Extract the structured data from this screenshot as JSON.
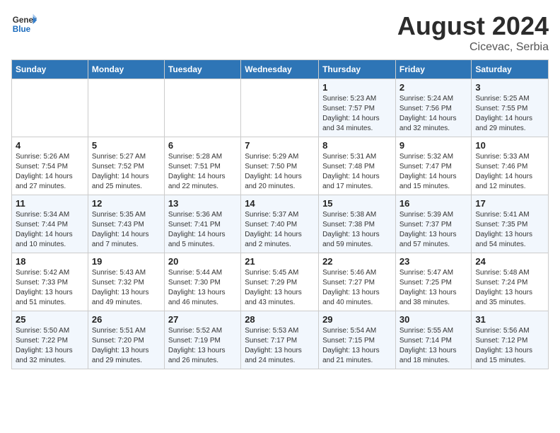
{
  "header": {
    "logo_text_general": "General",
    "logo_text_blue": "Blue",
    "main_title": "August 2024",
    "subtitle": "Cicevac, Serbia"
  },
  "days_of_week": [
    "Sunday",
    "Monday",
    "Tuesday",
    "Wednesday",
    "Thursday",
    "Friday",
    "Saturday"
  ],
  "weeks": [
    [
      {
        "day": "",
        "info": ""
      },
      {
        "day": "",
        "info": ""
      },
      {
        "day": "",
        "info": ""
      },
      {
        "day": "",
        "info": ""
      },
      {
        "day": "1",
        "info": "Sunrise: 5:23 AM\nSunset: 7:57 PM\nDaylight: 14 hours\nand 34 minutes."
      },
      {
        "day": "2",
        "info": "Sunrise: 5:24 AM\nSunset: 7:56 PM\nDaylight: 14 hours\nand 32 minutes."
      },
      {
        "day": "3",
        "info": "Sunrise: 5:25 AM\nSunset: 7:55 PM\nDaylight: 14 hours\nand 29 minutes."
      }
    ],
    [
      {
        "day": "4",
        "info": "Sunrise: 5:26 AM\nSunset: 7:54 PM\nDaylight: 14 hours\nand 27 minutes."
      },
      {
        "day": "5",
        "info": "Sunrise: 5:27 AM\nSunset: 7:52 PM\nDaylight: 14 hours\nand 25 minutes."
      },
      {
        "day": "6",
        "info": "Sunrise: 5:28 AM\nSunset: 7:51 PM\nDaylight: 14 hours\nand 22 minutes."
      },
      {
        "day": "7",
        "info": "Sunrise: 5:29 AM\nSunset: 7:50 PM\nDaylight: 14 hours\nand 20 minutes."
      },
      {
        "day": "8",
        "info": "Sunrise: 5:31 AM\nSunset: 7:48 PM\nDaylight: 14 hours\nand 17 minutes."
      },
      {
        "day": "9",
        "info": "Sunrise: 5:32 AM\nSunset: 7:47 PM\nDaylight: 14 hours\nand 15 minutes."
      },
      {
        "day": "10",
        "info": "Sunrise: 5:33 AM\nSunset: 7:46 PM\nDaylight: 14 hours\nand 12 minutes."
      }
    ],
    [
      {
        "day": "11",
        "info": "Sunrise: 5:34 AM\nSunset: 7:44 PM\nDaylight: 14 hours\nand 10 minutes."
      },
      {
        "day": "12",
        "info": "Sunrise: 5:35 AM\nSunset: 7:43 PM\nDaylight: 14 hours\nand 7 minutes."
      },
      {
        "day": "13",
        "info": "Sunrise: 5:36 AM\nSunset: 7:41 PM\nDaylight: 14 hours\nand 5 minutes."
      },
      {
        "day": "14",
        "info": "Sunrise: 5:37 AM\nSunset: 7:40 PM\nDaylight: 14 hours\nand 2 minutes."
      },
      {
        "day": "15",
        "info": "Sunrise: 5:38 AM\nSunset: 7:38 PM\nDaylight: 13 hours\nand 59 minutes."
      },
      {
        "day": "16",
        "info": "Sunrise: 5:39 AM\nSunset: 7:37 PM\nDaylight: 13 hours\nand 57 minutes."
      },
      {
        "day": "17",
        "info": "Sunrise: 5:41 AM\nSunset: 7:35 PM\nDaylight: 13 hours\nand 54 minutes."
      }
    ],
    [
      {
        "day": "18",
        "info": "Sunrise: 5:42 AM\nSunset: 7:33 PM\nDaylight: 13 hours\nand 51 minutes."
      },
      {
        "day": "19",
        "info": "Sunrise: 5:43 AM\nSunset: 7:32 PM\nDaylight: 13 hours\nand 49 minutes."
      },
      {
        "day": "20",
        "info": "Sunrise: 5:44 AM\nSunset: 7:30 PM\nDaylight: 13 hours\nand 46 minutes."
      },
      {
        "day": "21",
        "info": "Sunrise: 5:45 AM\nSunset: 7:29 PM\nDaylight: 13 hours\nand 43 minutes."
      },
      {
        "day": "22",
        "info": "Sunrise: 5:46 AM\nSunset: 7:27 PM\nDaylight: 13 hours\nand 40 minutes."
      },
      {
        "day": "23",
        "info": "Sunrise: 5:47 AM\nSunset: 7:25 PM\nDaylight: 13 hours\nand 38 minutes."
      },
      {
        "day": "24",
        "info": "Sunrise: 5:48 AM\nSunset: 7:24 PM\nDaylight: 13 hours\nand 35 minutes."
      }
    ],
    [
      {
        "day": "25",
        "info": "Sunrise: 5:50 AM\nSunset: 7:22 PM\nDaylight: 13 hours\nand 32 minutes."
      },
      {
        "day": "26",
        "info": "Sunrise: 5:51 AM\nSunset: 7:20 PM\nDaylight: 13 hours\nand 29 minutes."
      },
      {
        "day": "27",
        "info": "Sunrise: 5:52 AM\nSunset: 7:19 PM\nDaylight: 13 hours\nand 26 minutes."
      },
      {
        "day": "28",
        "info": "Sunrise: 5:53 AM\nSunset: 7:17 PM\nDaylight: 13 hours\nand 24 minutes."
      },
      {
        "day": "29",
        "info": "Sunrise: 5:54 AM\nSunset: 7:15 PM\nDaylight: 13 hours\nand 21 minutes."
      },
      {
        "day": "30",
        "info": "Sunrise: 5:55 AM\nSunset: 7:14 PM\nDaylight: 13 hours\nand 18 minutes."
      },
      {
        "day": "31",
        "info": "Sunrise: 5:56 AM\nSunset: 7:12 PM\nDaylight: 13 hours\nand 15 minutes."
      }
    ]
  ]
}
